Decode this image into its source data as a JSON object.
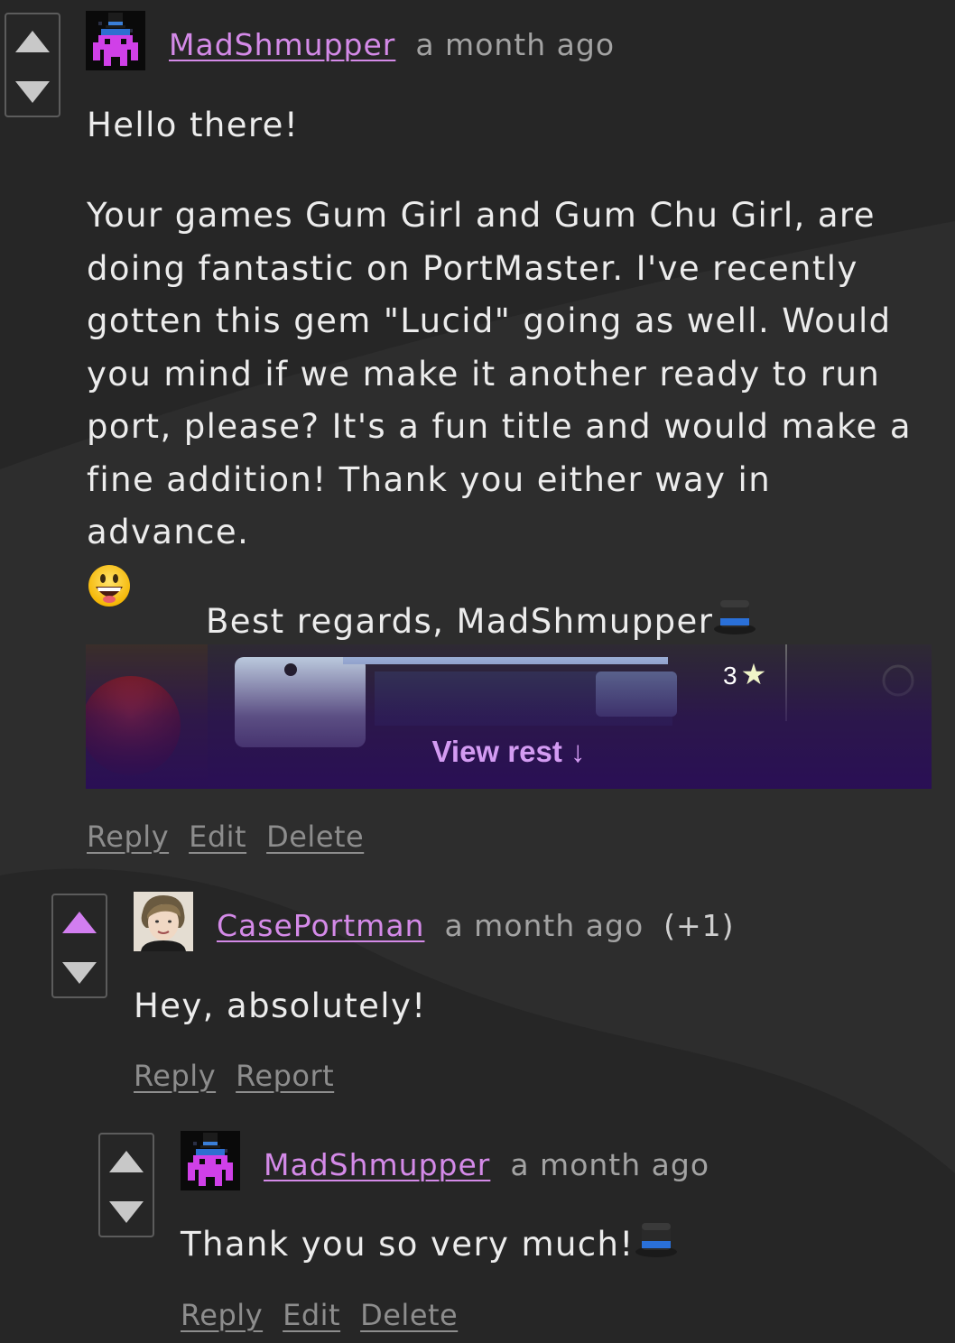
{
  "comments": [
    {
      "username": "MadShmupper",
      "time": "a month ago",
      "greeting": "Hello there!",
      "paragraph": "Your games Gum Girl and Gum Chu Girl, are doing fantastic on PortMaster. I've recently gotten this gem \"Lucid\" going as well. Would you mind if we make it another ready to run port, please? It's a fun title and would make a fine addition! Thank you either way in advance.",
      "emoji": "smiley-face-icon",
      "signoff": "Best regards, MadShmupper",
      "embed": {
        "rating": "3",
        "view_rest": "View rest ↓"
      },
      "actions": [
        "Reply",
        "Edit",
        "Delete"
      ]
    },
    {
      "username": "CasePortman",
      "time": "a month ago",
      "score": "(+1)",
      "body": "Hey, absolutely!",
      "upvoted": true,
      "actions": [
        "Reply",
        "Report"
      ]
    },
    {
      "username": "MadShmupper",
      "time": "a month ago",
      "body": "Thank you so very much!",
      "actions": [
        "Reply",
        "Edit",
        "Delete"
      ]
    }
  ],
  "colors": {
    "background": "#262626",
    "username": "#d48ae8",
    "timestamp": "#a3a3a3",
    "action_link": "#8d8d8d",
    "upvote_active": "#d27ef0"
  }
}
